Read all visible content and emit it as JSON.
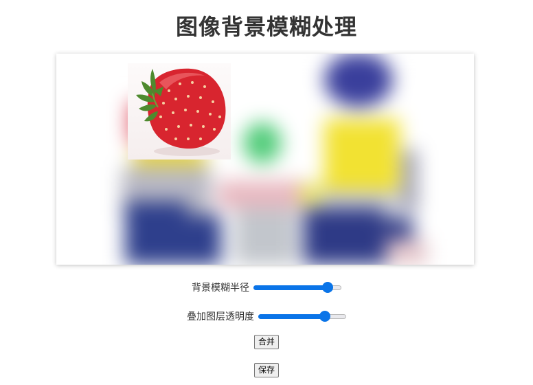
{
  "page": {
    "title": "图像背景模糊处理"
  },
  "canvas": {
    "sticker": "strawberry",
    "background": "blurred-people-scene"
  },
  "controls": {
    "blur_radius": {
      "label": "背景模糊半径",
      "value": 0.84
    },
    "layer_opacity": {
      "label": "叠加图层透明度",
      "value": 0.76
    },
    "merge_label": "合并",
    "save_label": "保存"
  },
  "colors": {
    "accent": "#0a74e8"
  }
}
